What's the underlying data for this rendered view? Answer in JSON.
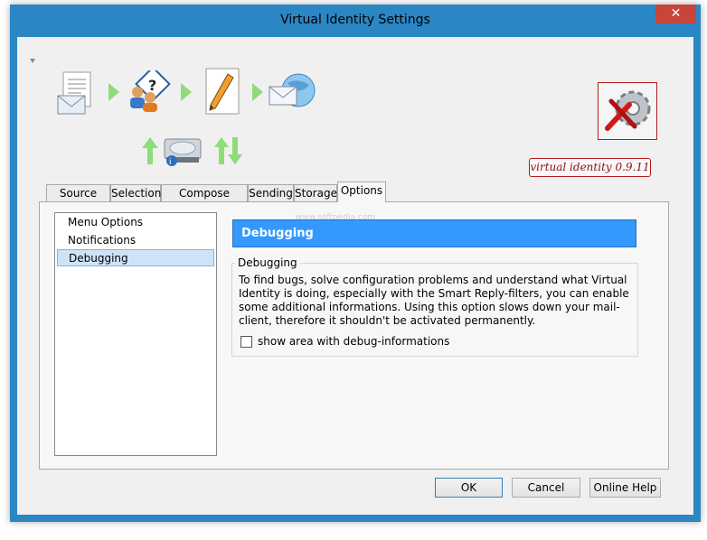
{
  "window": {
    "title": "Virtual Identity Settings"
  },
  "brand": {
    "version": "virtual identity 0.9.11"
  },
  "tabs": [
    {
      "label": "Source Mail"
    },
    {
      "label": "Selection"
    },
    {
      "label": "Compose Dialog"
    },
    {
      "label": "Sending"
    },
    {
      "label": "Storage"
    },
    {
      "label": "Options"
    }
  ],
  "sidebar": {
    "items": [
      {
        "label": "Menu Options"
      },
      {
        "label": "Notifications"
      },
      {
        "label": "Debugging"
      }
    ]
  },
  "content": {
    "header": "Debugging",
    "group_title": "Debugging",
    "description": "To find bugs, solve configuration problems and understand what Virtual Identity is doing, especially with the Smart Reply-filters, you can enable some additional informations. Using this option slows down your mail-client, therefore it shouldn't be activated permanently.",
    "checkbox_label": "show area with debug-informations"
  },
  "buttons": {
    "ok": "OK",
    "cancel": "Cancel",
    "help": "Online Help"
  },
  "watermark": "www.softpedia.com",
  "colors": {
    "accent": "#3399ff",
    "titlebar": "#2b86c4",
    "brand": "#b01c1c"
  }
}
